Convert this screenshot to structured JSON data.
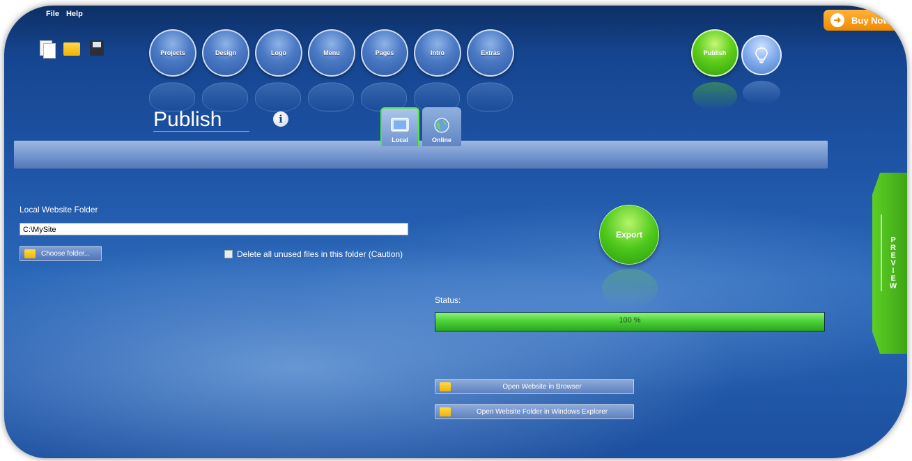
{
  "menu": {
    "items": [
      "File",
      "Help"
    ]
  },
  "toolbar": {
    "icons": [
      "new-file-icon",
      "open-folder-icon",
      "save-icon"
    ]
  },
  "nav": {
    "buttons": [
      {
        "label": "Projects"
      },
      {
        "label": "Design"
      },
      {
        "label": "Logo"
      },
      {
        "label": "Menu"
      },
      {
        "label": "Pages"
      },
      {
        "label": "Intro"
      },
      {
        "label": "Extras"
      }
    ],
    "publish": "Publish"
  },
  "buy_now": "Buy Now",
  "page": {
    "title": "Publish"
  },
  "tabs": [
    {
      "label": "Local",
      "active": true
    },
    {
      "label": "Online",
      "active": false
    }
  ],
  "local": {
    "folder_label": "Local Website Folder",
    "folder_value": "C:\\MySite",
    "choose_button": "Choose folder...",
    "delete_checkbox": {
      "label": "Delete all unused files in this folder (Caution)",
      "checked": false
    }
  },
  "export": {
    "label": "Export"
  },
  "status": {
    "label": "Status:",
    "progress_text": "100 %",
    "progress": 100
  },
  "actions": {
    "open_browser": "Open Website in Browser",
    "open_explorer": "Open Website Folder in Windows Explorer"
  },
  "preview": {
    "label": [
      "P",
      "R",
      "E",
      "V",
      "I",
      "E",
      "W"
    ]
  },
  "colors": {
    "accent_green": "#4fc81c",
    "background_blue": "#1e54a6",
    "buy_now_orange": "#f08a00"
  }
}
